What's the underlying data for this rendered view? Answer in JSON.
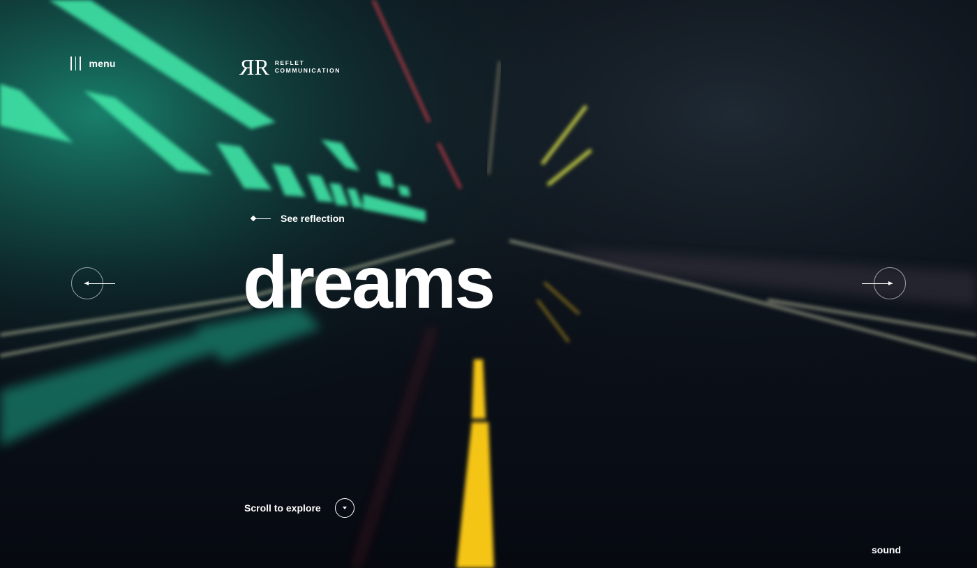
{
  "header": {
    "menu_label": "menu",
    "logo": {
      "mark": "RR",
      "line1": "REFLET",
      "line2": "COMMUNICATION"
    }
  },
  "hero": {
    "link_label": "See reflection",
    "headline": "dreams"
  },
  "footer": {
    "scroll_label": "Scroll to explore",
    "sound_label": "sound"
  },
  "icons": {
    "menu": "menu-lines-icon",
    "prev": "arrow-left-icon",
    "next": "arrow-right-icon",
    "scroll": "chevron-down-icon"
  },
  "colors": {
    "background": "#0b1018",
    "teal_light": "#3fe3a6",
    "road_line": "#f5c518",
    "red_light": "#d23a4b",
    "yellow_light": "#e3e94a",
    "text": "#ffffff"
  }
}
